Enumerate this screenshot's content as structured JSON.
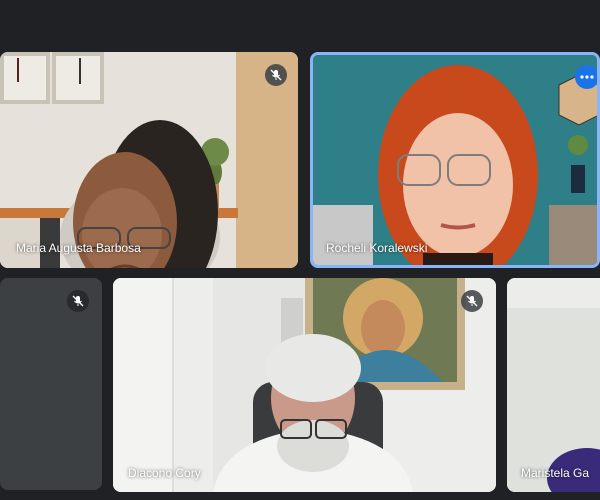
{
  "participants": [
    {
      "name": "Maria Augusta Barbosa",
      "muted": true
    },
    {
      "name": "Rocheli Koralewski",
      "muted": false,
      "active_speaker": true
    },
    {
      "name": "",
      "muted": true
    },
    {
      "name": "Diacono Cory",
      "muted": true
    },
    {
      "name": "Maristela Ga",
      "muted": false
    }
  ],
  "colors": {
    "background": "#202124",
    "active_border": "#8ab4f8",
    "more_button": "#1a73e8",
    "tile_gray": "#3c4043"
  },
  "icons": {
    "mic_off": "mic-off-icon",
    "more": "more-options-icon"
  }
}
